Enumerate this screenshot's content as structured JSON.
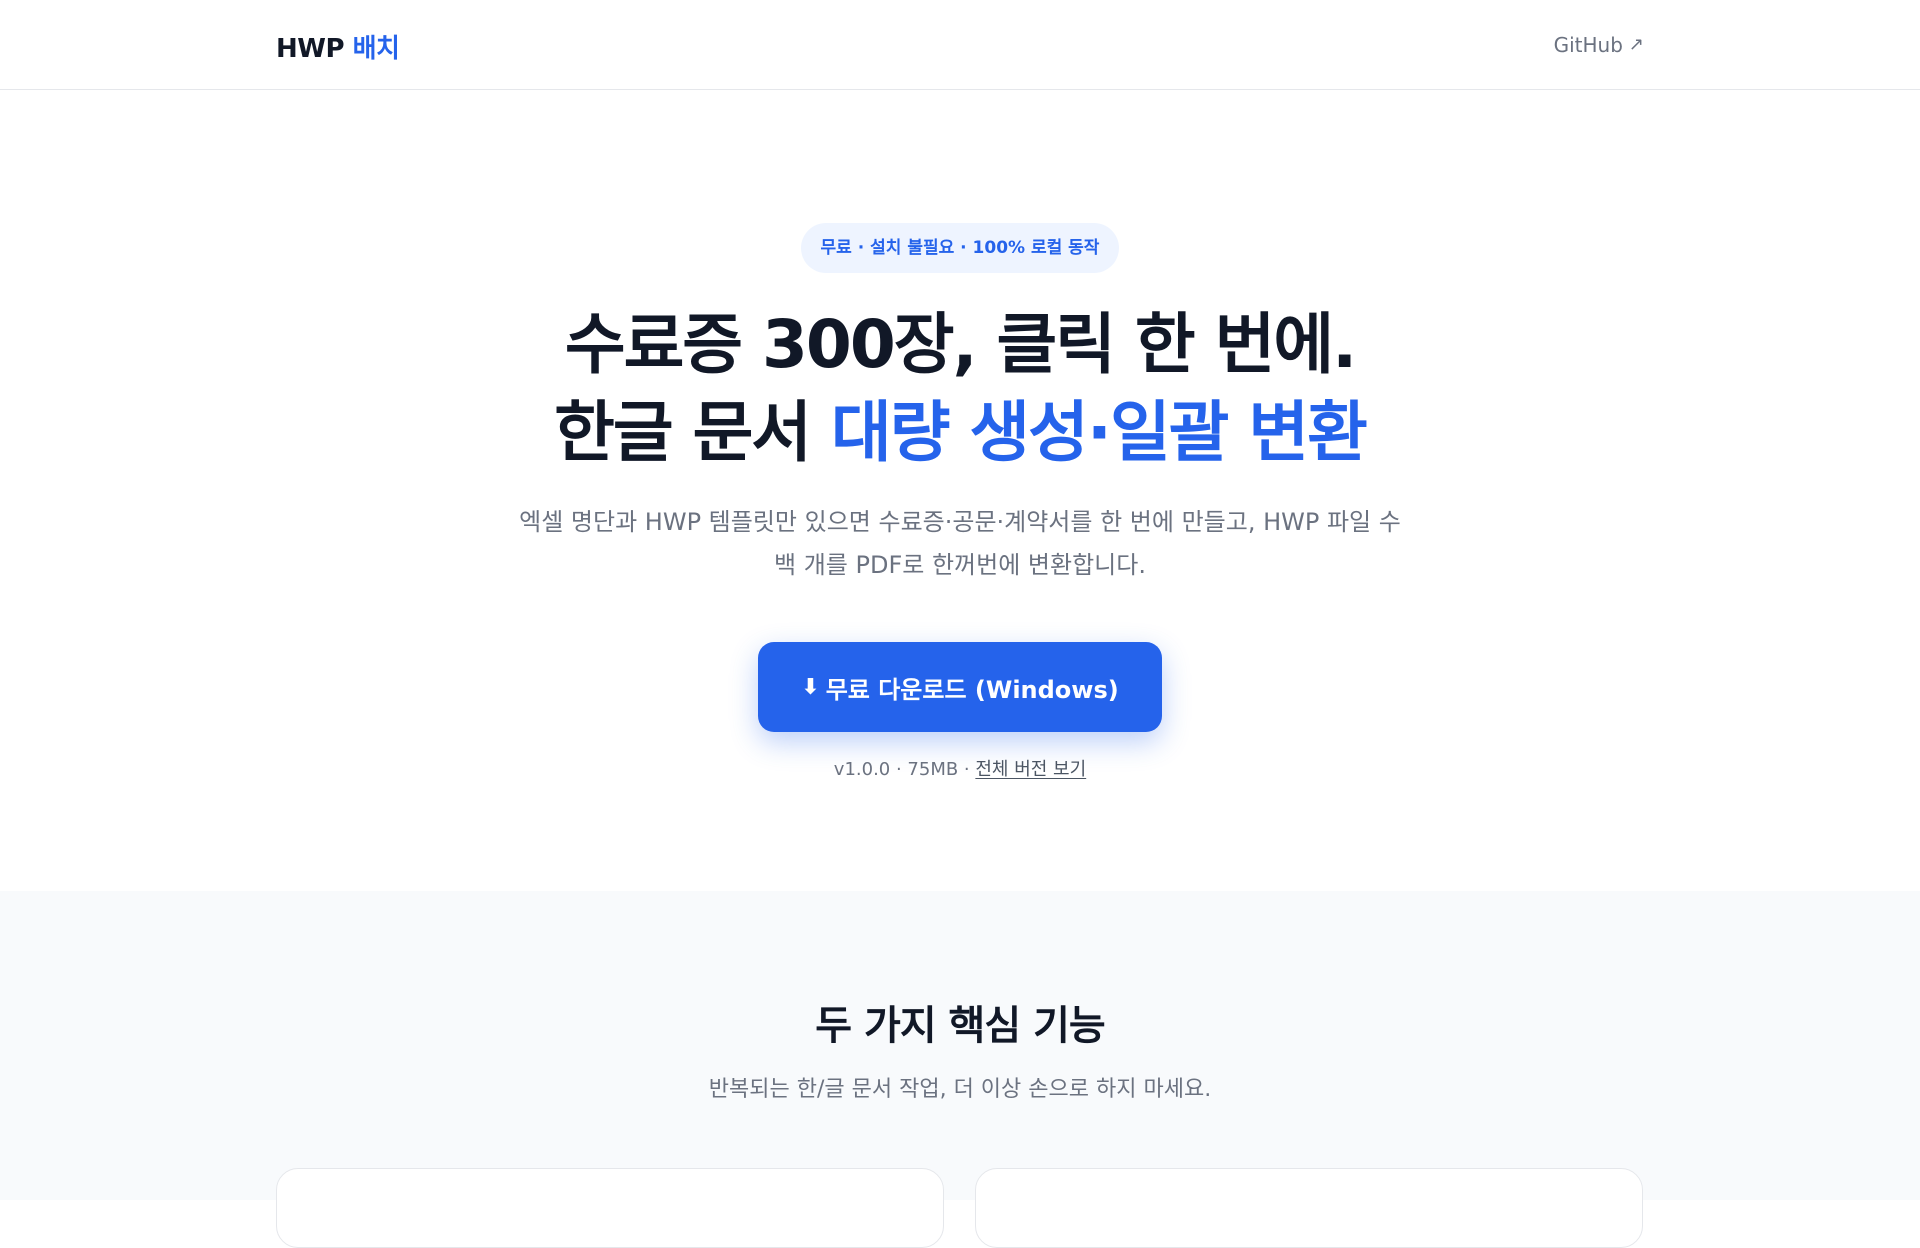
{
  "header": {
    "logo_main": "HWP",
    "logo_accent": "배치",
    "github_label": "GitHub",
    "github_icon": "external-arrow-icon"
  },
  "hero": {
    "badge": "무료 · 설치 불필요 · 100% 로컬 동작",
    "title_line1": "수료증 300장, 클릭 한 번에.",
    "title_line2_prefix": "한글 문서 ",
    "title_line2_highlight": "대량 생성·일괄 변환",
    "description": "엑셀 명단과 HWP 템플릿만 있으면 수료증·공문·계약서를 한 번에 만들고, HWP 파일 수백 개를 PDF로 한꺼번에 변환합니다.",
    "download_icon": "⬇",
    "download_label": "무료 다운로드 (Windows)",
    "version_info": "v1.0.0 · 75MB · ",
    "versions_link": "전체 버전 보기"
  },
  "features": {
    "title": "두 가지 핵심 기능",
    "subtitle": "반복되는 한/글 문서 작업, 더 이상 손으로 하지 마세요."
  },
  "colors": {
    "accent": "#2563eb",
    "text": "#111827",
    "muted": "#6b7280",
    "section_bg": "#f8fafc",
    "badge_bg": "#eef4ff"
  }
}
